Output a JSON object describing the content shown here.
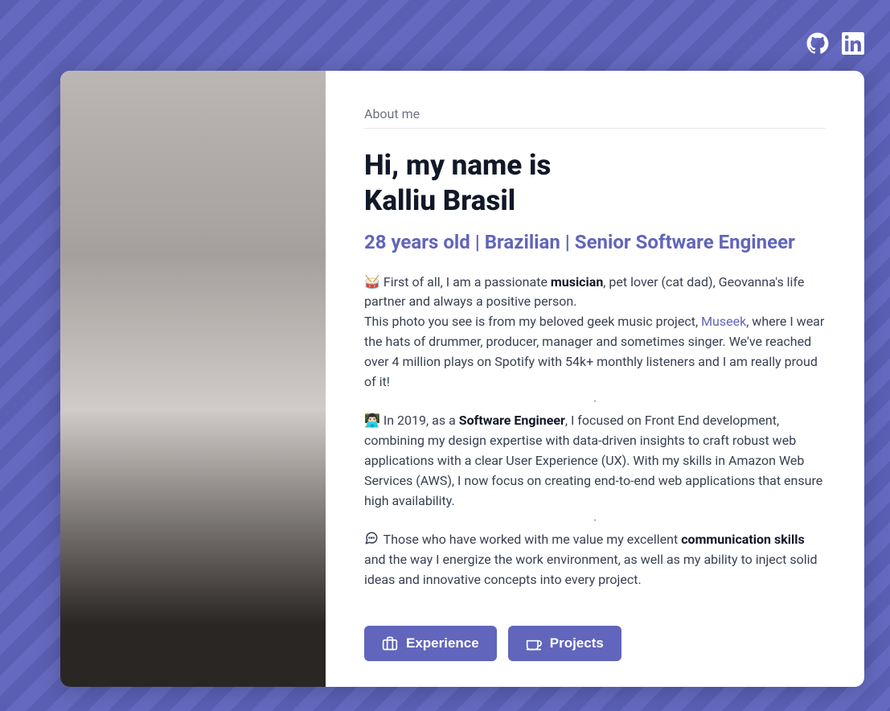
{
  "social": {
    "github": "github-icon",
    "linkedin": "linkedin-icon"
  },
  "section_label": "About me",
  "heading_line1": "Hi, my name is",
  "heading_line2": "Kalliu Brasil",
  "subtitle": "28 years old | Brazilian | Senior Software Engineer",
  "para1": {
    "prefix": "🥁 First of all, I am a passionate ",
    "bold1": "musician",
    "mid1": ", pet lover (cat dad), Geovanna's life partner and always a positive person.",
    "line2a": "This photo you see is from my beloved geek music project, ",
    "link": "Museek",
    "line2b": ", where I wear the hats of drummer, producer, manager and sometimes singer. We've reached over 4 million plays on Spotify with 54k+ monthly listeners and I am really proud of it!"
  },
  "para2": {
    "prefix": "👨🏻‍💻 In 2019, as a ",
    "bold1": "Software Engineer",
    "rest": ", I focused on Front End development, combining my design expertise with data-driven insights to craft robust web applications with a clear User Experience (UX). With my skills in Amazon Web Services (AWS), I now focus on creating end-to-end web applications that ensure high availability."
  },
  "para3": {
    "prefix": " Those who have worked with me value my excellent ",
    "bold1": "communication skills",
    "rest": " and the way I energize the work environment, as well as my ability to inject solid ideas and innovative concepts into every project."
  },
  "buttons": {
    "experience": "Experience",
    "projects": "Projects"
  }
}
